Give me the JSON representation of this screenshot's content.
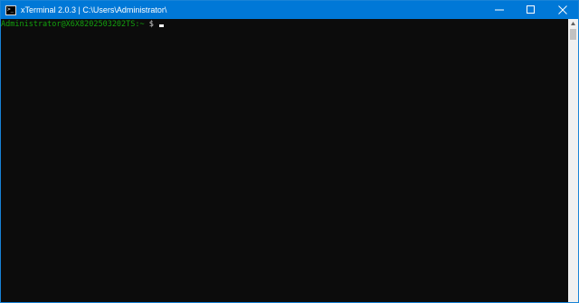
{
  "window": {
    "title": "xTerminal 2.0.3 | C:\\Users\\Administrator\\",
    "icon": "terminal-prompt-icon",
    "icon_glyph": ">_",
    "controls": [
      "minimize-icon",
      "maximize-icon",
      "close-icon"
    ],
    "accent_color": "#0078d7"
  },
  "terminal": {
    "prompt_user": "Administrator@X6X8202503202TS:~",
    "prompt_symbol": " $ ",
    "user_color": "#13a10e",
    "background_color": "#0c0c0c"
  }
}
